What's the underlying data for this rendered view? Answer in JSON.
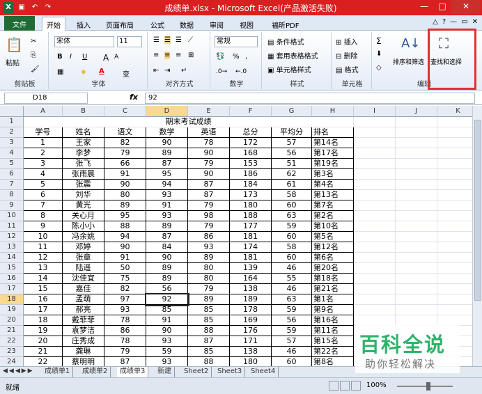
{
  "title_bar": {
    "title": "成绩单.xlsx - Microsoft Excel(产品激活失败)",
    "app_icon": "X",
    "save_icon": "save-icon",
    "undo_icon": "undo-icon",
    "redo_icon": "redo-icon",
    "min": "—",
    "max": "□",
    "close": "✕"
  },
  "ribbon_tabs": [
    "文件",
    "开始",
    "插入",
    "页面布局",
    "公式",
    "数据",
    "审阅",
    "视图",
    "福昕PDF"
  ],
  "ribbon": {
    "clipboard": {
      "paste": "粘贴",
      "label": "剪贴板"
    },
    "font": {
      "name": "宋体",
      "size": "11",
      "bold": "B",
      "italic": "I",
      "underline": "U",
      "grow": "A",
      "shrink": "A",
      "label": "字体",
      "wen": "变",
      "color_a": "A"
    },
    "alignment": {
      "label": "对齐方式"
    },
    "number": {
      "format": "常规",
      "percent": "%",
      "comma": ",",
      "label": "数字",
      "currency": "%"
    },
    "styles": {
      "cond": "条件格式",
      "table": "套用表格格式",
      "cell": "单元格样式",
      "label": "样式"
    },
    "cells": {
      "insert": "插入",
      "delete": "删除",
      "format": "格式",
      "label": "单元格"
    },
    "editing": {
      "sum": "Σ",
      "sort": "排序和筛选",
      "find": "查找和选择",
      "label": "编辑"
    }
  },
  "formula_bar": {
    "name_box": "D18",
    "fx": "fx",
    "value": "92"
  },
  "columns": [
    "A",
    "B",
    "C",
    "D",
    "E",
    "F",
    "G",
    "H",
    "I",
    "J",
    "K"
  ],
  "sheet": {
    "title": "期末考试成绩",
    "headers": [
      "学号",
      "姓名",
      "语文",
      "数学",
      "英语",
      "总分",
      "平均分",
      "排名"
    ],
    "rows": [
      [
        "1",
        "王家",
        "82",
        "90",
        "78",
        "172",
        "57",
        "第14名"
      ],
      [
        "2",
        "李梦",
        "79",
        "89",
        "90",
        "168",
        "56",
        "第17名"
      ],
      [
        "3",
        "张飞",
        "66",
        "87",
        "79",
        "153",
        "51",
        "第19名"
      ],
      [
        "4",
        "张雨晨",
        "91",
        "95",
        "90",
        "186",
        "62",
        "第3名"
      ],
      [
        "5",
        "张震",
        "90",
        "94",
        "87",
        "184",
        "61",
        "第4名"
      ],
      [
        "6",
        "刘华",
        "80",
        "93",
        "87",
        "173",
        "58",
        "第13名"
      ],
      [
        "7",
        "黄光",
        "89",
        "91",
        "79",
        "180",
        "60",
        "第7名"
      ],
      [
        "8",
        "关心月",
        "95",
        "93",
        "98",
        "188",
        "63",
        "第2名"
      ],
      [
        "9",
        "陈小小",
        "88",
        "89",
        "79",
        "177",
        "59",
        "第10名"
      ],
      [
        "10",
        "冯余姚",
        "94",
        "87",
        "86",
        "181",
        "60",
        "第5名"
      ],
      [
        "11",
        "邓婷",
        "90",
        "84",
        "93",
        "174",
        "58",
        "第12名"
      ],
      [
        "12",
        "张章",
        "91",
        "90",
        "89",
        "181",
        "60",
        "第6名"
      ],
      [
        "13",
        "陆遥",
        "50",
        "89",
        "80",
        "139",
        "46",
        "第20名"
      ],
      [
        "14",
        "沈佳宜",
        "75",
        "89",
        "80",
        "164",
        "55",
        "第18名"
      ],
      [
        "15",
        "嘉佳",
        "82",
        "56",
        "79",
        "138",
        "46",
        "第21名"
      ],
      [
        "16",
        "孟萌",
        "97",
        "92",
        "89",
        "189",
        "63",
        "第1名"
      ],
      [
        "17",
        "郝亮",
        "93",
        "85",
        "85",
        "178",
        "59",
        "第9名"
      ],
      [
        "18",
        "戴菲菲",
        "78",
        "91",
        "85",
        "169",
        "56",
        "第16名"
      ],
      [
        "19",
        "袁梦洁",
        "86",
        "90",
        "88",
        "176",
        "59",
        "第11名"
      ],
      [
        "20",
        "庄秀成",
        "78",
        "93",
        "87",
        "171",
        "57",
        "第15名"
      ],
      [
        "21",
        "龚琳",
        "79",
        "59",
        "85",
        "138",
        "46",
        "第22名"
      ],
      [
        "22",
        "蔡明明",
        "87",
        "93",
        "88",
        "180",
        "60",
        "第8名"
      ]
    ]
  },
  "sheet_tabs": [
    "成绩单1",
    "成绩单2",
    "成绩单3",
    "新建",
    "Sheet2",
    "Sheet3",
    "Sheet4"
  ],
  "status": {
    "ready": "就绪",
    "zoom": "100%"
  },
  "watermark": {
    "line1": "百科全说",
    "line2": "助你轻松解决"
  }
}
